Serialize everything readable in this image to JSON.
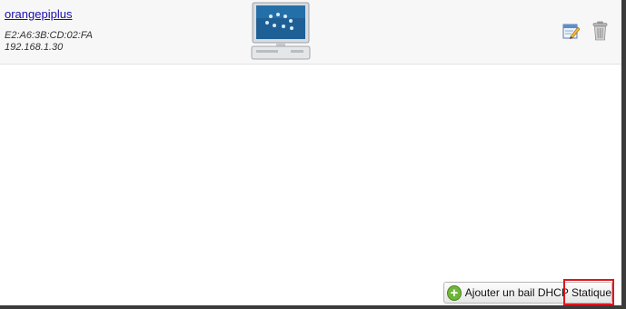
{
  "device": {
    "hostname": "orangepiplus",
    "mac": "E2:A6:3B:CD:02:FA",
    "ip": "192.168.1.30",
    "icon": "computer-icon",
    "actions": [
      {
        "name": "edit",
        "icon": "edit-icon"
      },
      {
        "name": "delete",
        "icon": "trash-icon"
      }
    ]
  },
  "footer": {
    "add_button_label": "Ajouter un bail DHCP Statique",
    "add_icon": "plus-circle-icon",
    "highlight_color": "#e3141b"
  },
  "colors": {
    "link": "#1a0dab",
    "row_background": "#f7f7f7",
    "add_green": "#6fb53a"
  }
}
